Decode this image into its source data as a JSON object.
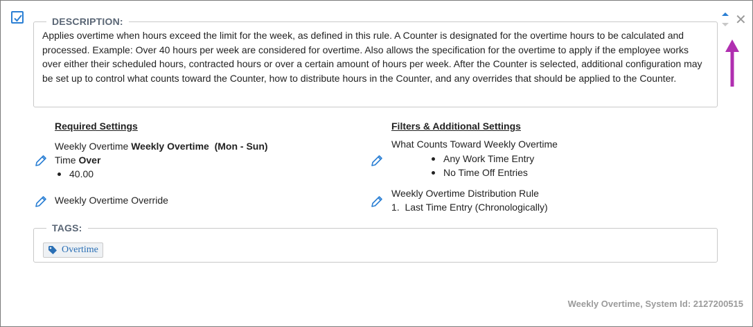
{
  "description": {
    "legend": "DESCRIPTION:",
    "text": "Applies overtime when hours exceed the limit for the week, as defined in this rule. A Counter is designated for the overtime hours to be calculated and processed. Example: Over 40 hours per week are considered for overtime. Also allows the specification for the overtime to apply if the employee works over either their scheduled hours, contracted hours or over a certain amount of hours per week. After the Counter is selected, additional configuration may be set up to control what counts toward the Counter, how to distribute hours in the Counter, and any overrides that should be applied to the Counter."
  },
  "required": {
    "heading": "Required Settings",
    "weekly_overtime": {
      "prefix": "Weekly Overtime",
      "name": "Weekly Overtime",
      "range": "(Mon - Sun)",
      "time_label": "Time",
      "time_mode": "Over",
      "value": "40.00"
    },
    "override": "Weekly Overtime Override"
  },
  "filters": {
    "heading": "Filters & Additional Settings",
    "counts_toward": {
      "title": "What Counts Toward Weekly Overtime",
      "items": [
        "Any Work Time Entry",
        "No Time Off Entries"
      ]
    },
    "distribution": {
      "title": "Weekly Overtime Distribution Rule",
      "item_number": "1.",
      "item": "Last Time Entry (Chronologically)"
    }
  },
  "tags": {
    "legend": "TAGS:",
    "items": [
      "Overtime"
    ]
  },
  "footer": "Weekly Overtime, System Id: 2127200515",
  "colors": {
    "accent": "#2a7fd4",
    "arrow": "#b02fb0",
    "footer_text": "#9b9b9b"
  },
  "icons": [
    "checkbox-checked-icon",
    "sort-up-down-icon",
    "close-icon",
    "pencil-icon",
    "tag-icon",
    "annotation-arrow-icon"
  ]
}
